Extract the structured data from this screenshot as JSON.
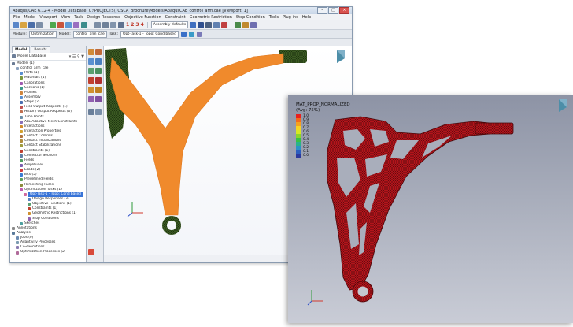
{
  "window": {
    "title": "Abaqus/CAE 6.12-4 - Model Database: U:\\PROJECTS\\TOSCA_Brochure\\Models\\AbaqusCAE_control_arm.cae [Viewport: 1]"
  },
  "menu": [
    "File",
    "Model",
    "Viewport",
    "View",
    "Task",
    "Design Response",
    "Objective Function",
    "Constraint",
    "Geometric Restriction",
    "Stop Condition",
    "Tools",
    "Plug-ins",
    "Help"
  ],
  "toolbar": {
    "digits": [
      "1",
      "2",
      "3",
      "4"
    ],
    "assembly_dropdown": "Assembly defaults"
  },
  "context": {
    "module_label": "Module:",
    "module_value": "Optimization",
    "model_label": "Model:",
    "model_value": "control_arm_cae",
    "task_label": "Task:",
    "task_value": "Opt-Task-1 - Topo: Cond based"
  },
  "tabs": [
    "Model",
    "Results"
  ],
  "tree_header": "Model Database",
  "tree": [
    {
      "label": "Models (1)",
      "indent": 0,
      "color": "#6a7b94"
    },
    {
      "label": "control_arm_cae",
      "indent": 1,
      "color": "#8aa0bd"
    },
    {
      "label": "Parts (1)",
      "indent": 2,
      "color": "#5a8fd0"
    },
    {
      "label": "Materials (1)",
      "indent": 2,
      "color": "#7c9a3f"
    },
    {
      "label": "Calibrations",
      "indent": 2,
      "color": "#a05ab0"
    },
    {
      "label": "Sections (1)",
      "indent": 2,
      "color": "#3c9a8a"
    },
    {
      "label": "Profiles",
      "indent": 2,
      "color": "#d0853c"
    },
    {
      "label": "Assembly",
      "indent": 2,
      "color": "#5a8fd0"
    },
    {
      "label": "Steps (2)",
      "indent": 2,
      "color": "#4a6fb0"
    },
    {
      "label": "Field Output Requests (1)",
      "indent": 2,
      "color": "#c05050"
    },
    {
      "label": "History Output Requests (0)",
      "indent": 2,
      "color": "#c07050"
    },
    {
      "label": "Time Points",
      "indent": 2,
      "color": "#6b8fa8"
    },
    {
      "label": "ALE Adaptive Mesh Constraints",
      "indent": 2,
      "color": "#8a6fb8"
    },
    {
      "label": "Interactions",
      "indent": 2,
      "color": "#d28c2e"
    },
    {
      "label": "Interaction Properties",
      "indent": 2,
      "color": "#d2a12e"
    },
    {
      "label": "Contact Controls",
      "indent": 2,
      "color": "#b0733c"
    },
    {
      "label": "Contact Initializations",
      "indent": 2,
      "color": "#b08c3c"
    },
    {
      "label": "Contact Stabilizations",
      "indent": 2,
      "color": "#a09c3c"
    },
    {
      "label": "Constraints (1)",
      "indent": 2,
      "color": "#c0402f"
    },
    {
      "label": "Connector Sections",
      "indent": 2,
      "color": "#5f7fa5"
    },
    {
      "label": "Fields",
      "indent": 2,
      "color": "#4f9f5f"
    },
    {
      "label": "Amplitudes",
      "indent": 2,
      "color": "#7c60b0"
    },
    {
      "label": "Loads (2)",
      "indent": 2,
      "color": "#d23c3c"
    },
    {
      "label": "BCs (5)",
      "indent": 2,
      "color": "#3c7cd2"
    },
    {
      "label": "Predefined Fields",
      "indent": 2,
      "color": "#5aa05a"
    },
    {
      "label": "Remeshing Rules",
      "indent": 2,
      "color": "#8c8c3c"
    },
    {
      "label": "Optimization Tasks (1)",
      "indent": 2,
      "color": "#c05ab0"
    },
    {
      "label": "Opt-Task-1 - Topo: Cond based",
      "indent": 3,
      "color": "#d06aa0",
      "selected": true
    },
    {
      "label": "Design Responses (3)",
      "indent": 4,
      "color": "#5a80c0"
    },
    {
      "label": "Objective Functions (1)",
      "indent": 4,
      "color": "#5aa070"
    },
    {
      "label": "Constraints (1)",
      "indent": 4,
      "color": "#c0402f"
    },
    {
      "label": "Geometric Restrictions (1)",
      "indent": 4,
      "color": "#d09030"
    },
    {
      "label": "Stop Conditions",
      "indent": 4,
      "color": "#9060b0"
    },
    {
      "label": "Sketches",
      "indent": 2,
      "color": "#4fa0a0"
    },
    {
      "label": "Annotations",
      "indent": 0,
      "color": "#8a8a8a"
    },
    {
      "label": "Analysis",
      "indent": 0,
      "color": "#5a7a9a"
    },
    {
      "label": "Jobs (0)",
      "indent": 1,
      "color": "#6a8ab0"
    },
    {
      "label": "Adaptivity Processes",
      "indent": 1,
      "color": "#7a9ab0"
    },
    {
      "label": "Co-executions",
      "indent": 1,
      "color": "#8a7ab0"
    },
    {
      "label": "Optimization Processes (2)",
      "indent": 1,
      "color": "#b06a9a"
    }
  ],
  "result": {
    "variable": "MAT_PROP_NORMALIZED",
    "averaging": "(Avg: 75%)",
    "legend": [
      {
        "value": "1.0",
        "color": "#e8201e"
      },
      {
        "value": "0.9",
        "color": "#f26a1d"
      },
      {
        "value": "0.8",
        "color": "#f5a11f"
      },
      {
        "value": "0.7",
        "color": "#f8d323"
      },
      {
        "value": "0.6",
        "color": "#d7e624"
      },
      {
        "value": "0.5",
        "color": "#8bd42a"
      },
      {
        "value": "0.4",
        "color": "#38c146"
      },
      {
        "value": "0.3",
        "color": "#28b48a"
      },
      {
        "value": "0.2",
        "color": "#2b93c6"
      },
      {
        "value": "0.1",
        "color": "#2d5fbf"
      },
      {
        "value": "0.0",
        "color": "#2c3a9e"
      }
    ]
  },
  "colors": {
    "model_orange": "#f08a2c",
    "mesh_green": "#2f4f1a",
    "result_red": "#b3141b"
  }
}
